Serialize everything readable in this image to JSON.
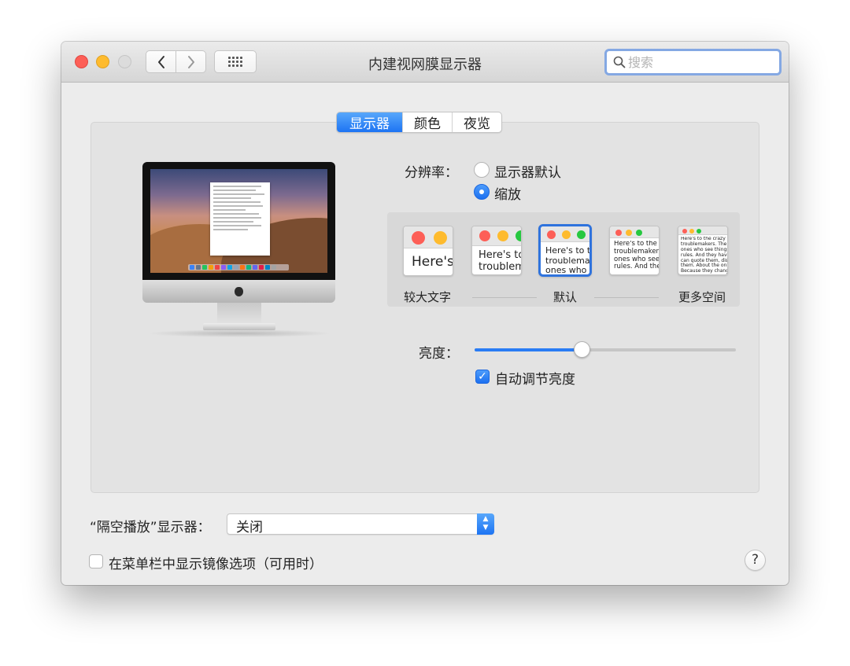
{
  "window": {
    "title": "内建视网膜显示器"
  },
  "search": {
    "placeholder": "搜索",
    "value": ""
  },
  "tabs": [
    {
      "label": "显示器",
      "active": true
    },
    {
      "label": "颜色",
      "active": false
    },
    {
      "label": "夜览",
      "active": false
    }
  ],
  "resolution": {
    "label": "分辨率：",
    "options": [
      {
        "label": "显示器默认",
        "selected": false
      },
      {
        "label": "缩放",
        "selected": true
      }
    ]
  },
  "scaling": {
    "thumbnails": [
      {
        "text": "Here's",
        "selected": false
      },
      {
        "text": "Here's to\ntroublem",
        "selected": false
      },
      {
        "text": "Here's to th\ntroublemak\nones who s",
        "selected": true
      },
      {
        "text": "Here's to the cr\ntroublemakers.\nones who see t\nrules. And they",
        "selected": false
      },
      {
        "text": "Here's to the crazy one\ntroublemakers. The rou\nones who see things di\nrules. And they have no\ncan quote them, disagr\nthem. About the only th\nBecause they change th",
        "selected": false
      }
    ],
    "labels": {
      "larger": "较大文字",
      "default": "默认",
      "more": "更多空间"
    }
  },
  "brightness": {
    "label": "亮度：",
    "level": 0.41,
    "auto_label": "自动调节亮度",
    "auto_checked": true
  },
  "airplay": {
    "label": "“隔空播放”显示器：",
    "value": "关闭"
  },
  "mirror": {
    "label": "在菜单栏中显示镜像选项（可用时）",
    "checked": false
  },
  "help": {
    "label": "?"
  },
  "colors": {
    "accent": "#1d74f3",
    "close": "#fd5f57",
    "minimize": "#febb2e",
    "zoom_disabled": "#dcdcdc"
  }
}
